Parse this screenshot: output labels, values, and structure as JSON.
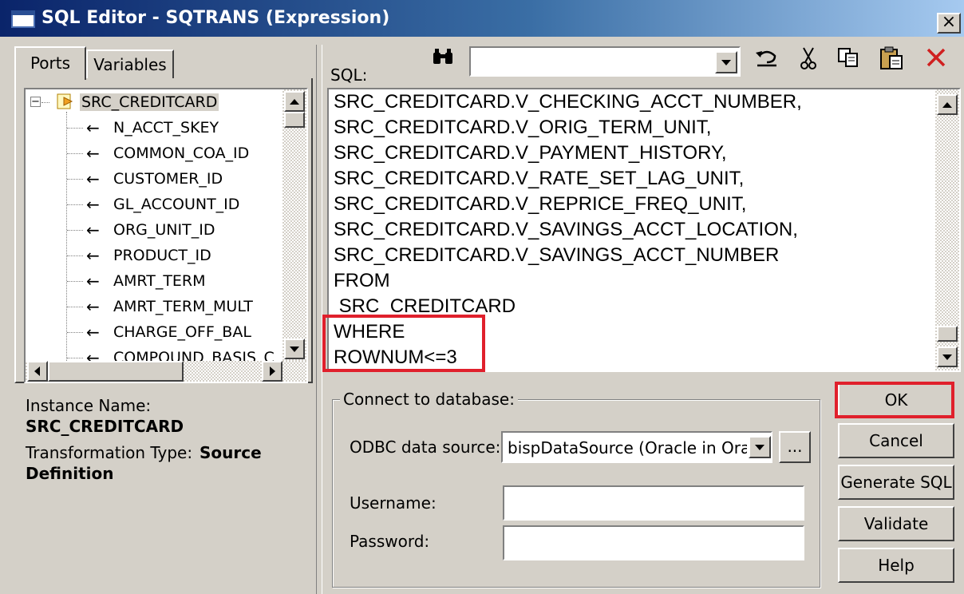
{
  "window": {
    "title": "SQL Editor - SQTRANS (Expression)",
    "close_glyph": "×"
  },
  "tabs": [
    {
      "label": "Ports"
    },
    {
      "label": "Variables"
    }
  ],
  "tree": {
    "root": "SRC_CREDITCARD",
    "items": [
      "N_ACCT_SKEY",
      "COMMON_COA_ID",
      "CUSTOMER_ID",
      "GL_ACCOUNT_ID",
      "ORG_UNIT_ID",
      "PRODUCT_ID",
      "AMRT_TERM",
      "AMRT_TERM_MULT",
      "CHARGE_OFF_BAL",
      "COMPOUND_BASIS_C"
    ]
  },
  "instance": {
    "name_label": "Instance Name:",
    "name_value": "SRC_CREDITCARD",
    "type_label": "Transformation Type:",
    "type_value_1": "Source",
    "type_value_2": "Definition"
  },
  "sql": {
    "label": "SQL:",
    "search_value": "",
    "lines": [
      "SRC_CREDITCARD.V_CHECKING_ACCT_NUMBER,",
      "SRC_CREDITCARD.V_ORIG_TERM_UNIT,",
      "SRC_CREDITCARD.V_PAYMENT_HISTORY,",
      "SRC_CREDITCARD.V_RATE_SET_LAG_UNIT,",
      "SRC_CREDITCARD.V_REPRICE_FREQ_UNIT,",
      "SRC_CREDITCARD.V_SAVINGS_ACCT_LOCATION,",
      "SRC_CREDITCARD.V_SAVINGS_ACCT_NUMBER",
      "FROM",
      " SRC_CREDITCARD",
      "WHERE",
      "ROWNUM<=3"
    ]
  },
  "connect": {
    "group_label": "Connect to database:",
    "odbc_label": "ODBC data source:",
    "odbc_value": "bispDataSource (Oracle in OraD",
    "browse_label": "...",
    "username_label": "Username:",
    "username_value": "",
    "password_label": "Password:",
    "password_value": ""
  },
  "buttons": {
    "ok": "OK",
    "cancel": "Cancel",
    "generate": "Generate SQL",
    "validate": "Validate",
    "help": "Help"
  },
  "colors": {
    "highlight": "#e0202c",
    "titlebar": "#0a246a"
  }
}
